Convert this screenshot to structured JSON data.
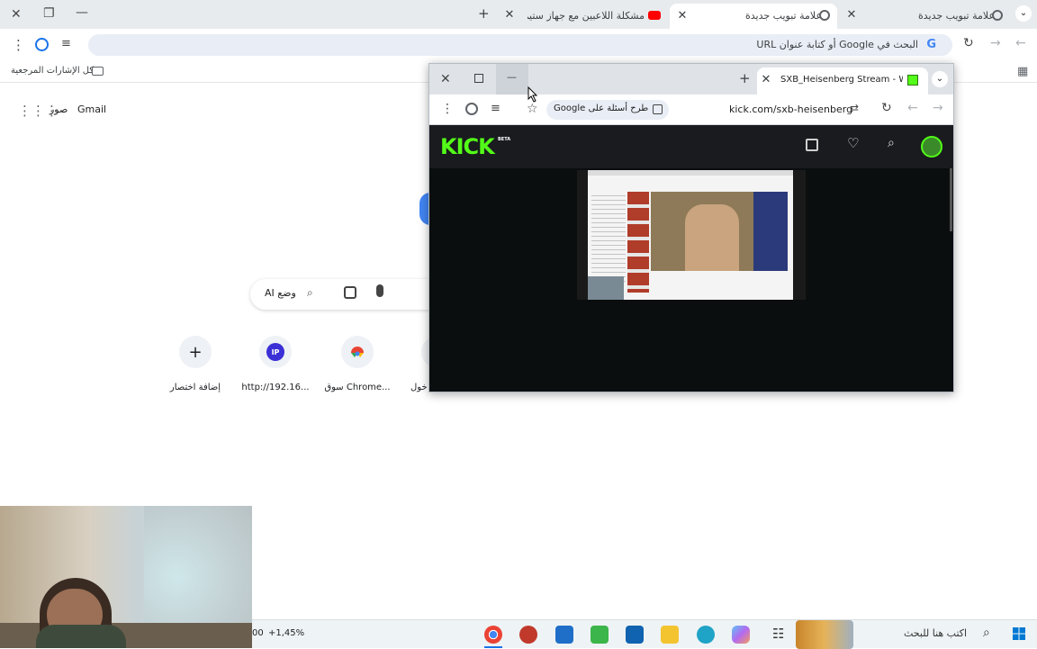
{
  "background_browser": {
    "tabs": [
      {
        "title": "علامة تبويب جديدة",
        "active": false
      },
      {
        "title": "علامة تبويب جديدة",
        "active": true
      },
      {
        "title": "مشكلة اللاعبين مع جهاز ستيم الن",
        "active": false
      }
    ],
    "omnibox_placeholder": "البحث في Google أو كتابة عنوان URL",
    "bookmarks_all": "كل الإشارات المرجعية"
  },
  "ntp": {
    "gmail": "Gmail",
    "images": "صور",
    "search_mode": "وضع AI",
    "shortcuts": [
      {
        "label": "إضافة اختصار",
        "icon": "plus-icon"
      },
      {
        "label": "http://192.16...",
        "icon": "ip-icon",
        "icon_text": "IP"
      },
      {
        "label": "سوق Chrome...",
        "icon": "chrome-webstore-icon"
      },
      {
        "label": "خول",
        "icon": "partial-shortcut-icon"
      }
    ]
  },
  "popup": {
    "tab_title": "SXB_Heisenberg Stream - Watc",
    "url": "kick.com/sxb-heisenberg",
    "ask_google": "طرح أسئلة على Google",
    "logo_text": "KICK",
    "logo_badge": "BETA"
  },
  "taskbar": {
    "search_placeholder": "اكتب هنا للبحث",
    "stock_text": "+1,45%",
    "stock_prefix": "00"
  },
  "colors": {
    "kick_green": "#53fc18",
    "accent_blue": "#1a73e8",
    "popup_dark": "#0b0e0f"
  }
}
